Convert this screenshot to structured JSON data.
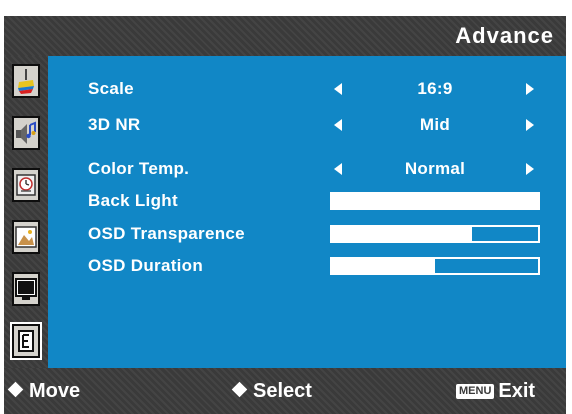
{
  "header": {
    "title": "Advance"
  },
  "sidebar": {
    "items": [
      {
        "icon": "brush-icon",
        "active": false
      },
      {
        "icon": "speaker-music-icon",
        "active": false
      },
      {
        "icon": "clock-icon",
        "active": false
      },
      {
        "icon": "picture-icon",
        "active": false
      },
      {
        "icon": "monitor-icon",
        "active": false
      },
      {
        "icon": "advance-settings-icon",
        "active": true
      }
    ]
  },
  "menu": {
    "items": [
      {
        "label": "Scale",
        "kind": "select",
        "value": "16:9"
      },
      {
        "label": "3D NR",
        "kind": "select",
        "value": "Mid"
      },
      {
        "label": "Color Temp.",
        "kind": "select",
        "value": "Normal"
      },
      {
        "label": "Back Light",
        "kind": "bar",
        "level": 1.0
      },
      {
        "label": "OSD Transparence",
        "kind": "bar",
        "level": 0.68
      },
      {
        "label": "OSD Duration",
        "kind": "bar",
        "level": 0.5
      }
    ]
  },
  "footer": {
    "move": "Move",
    "select": "Select",
    "menu_key": "MENU",
    "exit": "Exit"
  },
  "colors": {
    "panel": "#1187c6",
    "frame": "#3a3a3a",
    "text": "#ffffff"
  }
}
